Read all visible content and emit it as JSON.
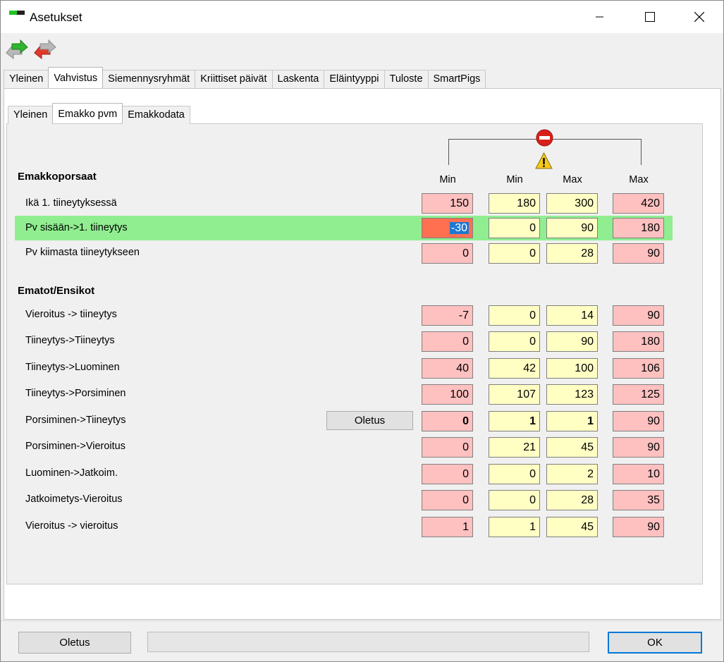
{
  "window": {
    "title": "Asetukset"
  },
  "toolbar": {
    "icons": [
      "reload-green-arrows-icon",
      "reload-red-arrows-icon"
    ]
  },
  "outer_tabs": [
    "Yleinen",
    "Vahvistus",
    "Siemennysryhmät",
    "Kriittiset päivät",
    "Laskenta",
    "Eläintyyppi",
    "Tuloste",
    "SmartPigs"
  ],
  "outer_active": "Vahvistus",
  "inner_tabs": [
    "Yleinen",
    "Emakko pvm",
    "Emakkodata"
  ],
  "inner_active": "Emakko pvm",
  "columns": [
    "Min",
    "Min",
    "Max",
    "Max"
  ],
  "section1": {
    "title": "Emakkoporsaat",
    "rows": [
      {
        "label": "Ikä 1. tiineytyksessä",
        "v": [
          "150",
          "180",
          "300",
          "420"
        ]
      },
      {
        "label": "Pv sisään->1. tiineytys",
        "v": [
          "-30",
          "0",
          "90",
          "180"
        ]
      },
      {
        "label": "Pv kiimasta tiineytykseen",
        "v": [
          "0",
          "0",
          "28",
          "90"
        ]
      }
    ]
  },
  "section2": {
    "title": "Ematot/Ensikot",
    "rows": [
      {
        "label": "Vieroitus -> tiineytys",
        "v": [
          "-7",
          "0",
          "14",
          "90"
        ]
      },
      {
        "label": "Tiineytys->Tiineytys",
        "v": [
          "0",
          "0",
          "90",
          "180"
        ]
      },
      {
        "label": "Tiineytys->Luominen",
        "v": [
          "40",
          "42",
          "100",
          "106"
        ]
      },
      {
        "label": "Tiineytys->Porsiminen",
        "v": [
          "100",
          "107",
          "123",
          "125"
        ]
      },
      {
        "label": "Porsiminen->Tiineytys",
        "v": [
          "0",
          "1",
          "1",
          "90"
        ]
      },
      {
        "label": "Porsiminen->Vieroitus",
        "v": [
          "0",
          "21",
          "45",
          "90"
        ]
      },
      {
        "label": "Luominen->Jatkoim.",
        "v": [
          "0",
          "0",
          "2",
          "10"
        ]
      },
      {
        "label": "Jatkoimetys-Vieroitus",
        "v": [
          "0",
          "0",
          "28",
          "35"
        ]
      },
      {
        "label": "Vieroitus -> vieroitus",
        "v": [
          "1",
          "1",
          "45",
          "90"
        ]
      }
    ]
  },
  "row_default_button": "Oletus",
  "footer": {
    "default_button": "Oletus",
    "ok_button": "OK"
  },
  "colors": {
    "error_field": "#ffc0c0",
    "warning_field": "#ffffc4",
    "highlight_row": "#90ee90",
    "selected_error": "#ff7050"
  }
}
